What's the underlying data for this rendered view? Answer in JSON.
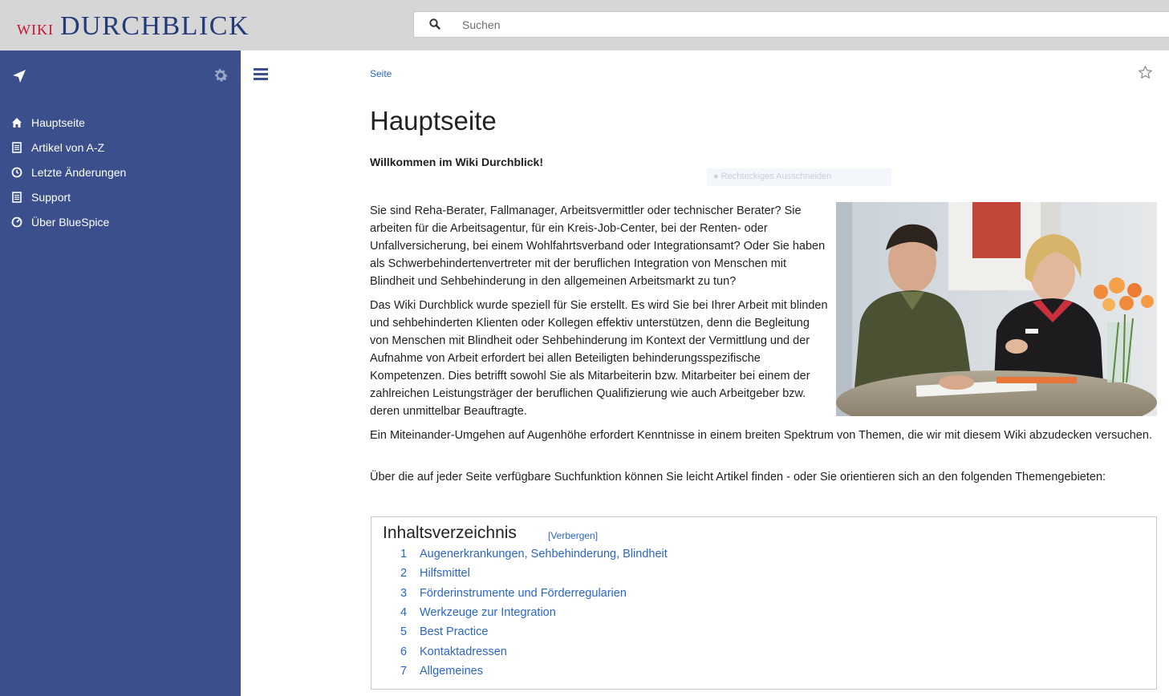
{
  "header": {
    "logo_prefix": "WIKI",
    "logo_main": "DURCHBLICK",
    "search_placeholder": "Suchen",
    "brand_colors": {
      "logo_red": "#c8102e",
      "logo_blue": "#233b7a",
      "sidebar_bg": "#3b4f8c",
      "link": "#2a66c9"
    }
  },
  "sidebar": {
    "nav_icon": "location-arrow-icon",
    "settings_icon": "gear-icon",
    "items": [
      {
        "label": "Hauptseite",
        "icon": "home-icon"
      },
      {
        "label": "Artikel von A-Z",
        "icon": "document-icon"
      },
      {
        "label": "Letzte Änderungen",
        "icon": "clock-icon"
      },
      {
        "label": "Support",
        "icon": "document-icon"
      },
      {
        "label": "Über BlueSpice",
        "icon": "gauge-icon"
      }
    ]
  },
  "page": {
    "breadcrumb": "Seite",
    "title": "Hauptseite",
    "welcome": "Willkommen im Wiki Durchblick!",
    "overlay_text": "Rechteckiges Ausschneiden",
    "paragraphs": [
      "Sie sind Reha-Berater, Fallmanager, Arbeitsvermittler oder technischer Berater? Sie arbeiten für die Arbeitsagentur, für ein Kreis-Job-Center, bei der Renten- oder Unfallversicherung, bei einem Wohlfahrtsverband oder Integrationsamt? Oder Sie haben als Schwerbehindertenvertreter mit der beruflichen Integration von Menschen mit Blindheit und Sehbehinderung in den allgemeinen Arbeitsmarkt zu tun?",
      "Das Wiki Durchblick wurde speziell für Sie erstellt. Es wird Sie bei Ihrer Arbeit mit blinden und sehbehinderten Klienten oder Kollegen effektiv unterstützen, denn die Begleitung von Menschen mit Blindheit oder Sehbehinderung im Kontext der Vermittlung und der Aufnahme von Arbeit erfordert bei allen Beteiligten behinderungsspezifische Kompetenzen. Dies betrifft sowohl Sie als Mitarbeiterin bzw. Mitarbeiter bei einem der zahlreichen Leistungsträger der beruflichen Qualifizierung wie auch Arbeitgeber bzw. deren unmittelbar Beauftragte.",
      "Ein Miteinander-Umgehen auf Augenhöhe erfordert Kenntnisse in einem breiten Spektrum von Themen, die wir mit diesem Wiki abzudecken versuchen.",
      "Über die auf jeder Seite verfügbare Suchfunktion können Sie leicht Artikel finden - oder Sie orientieren sich an den folgenden Themengebieten:"
    ]
  },
  "toc": {
    "title": "Inhaltsverzeichnis",
    "toggle": "[Verbergen]",
    "items": [
      {
        "num": "1",
        "label": "Augenerkrankungen, Sehbehinderung, Blindheit"
      },
      {
        "num": "2",
        "label": "Hilfsmittel"
      },
      {
        "num": "3",
        "label": "Förderinstrumente und Förderregularien"
      },
      {
        "num": "4",
        "label": "Werkzeuge zur Integration"
      },
      {
        "num": "5",
        "label": "Best Practice"
      },
      {
        "num": "6",
        "label": "Kontaktadressen"
      },
      {
        "num": "7",
        "label": "Allgemeines"
      }
    ]
  }
}
